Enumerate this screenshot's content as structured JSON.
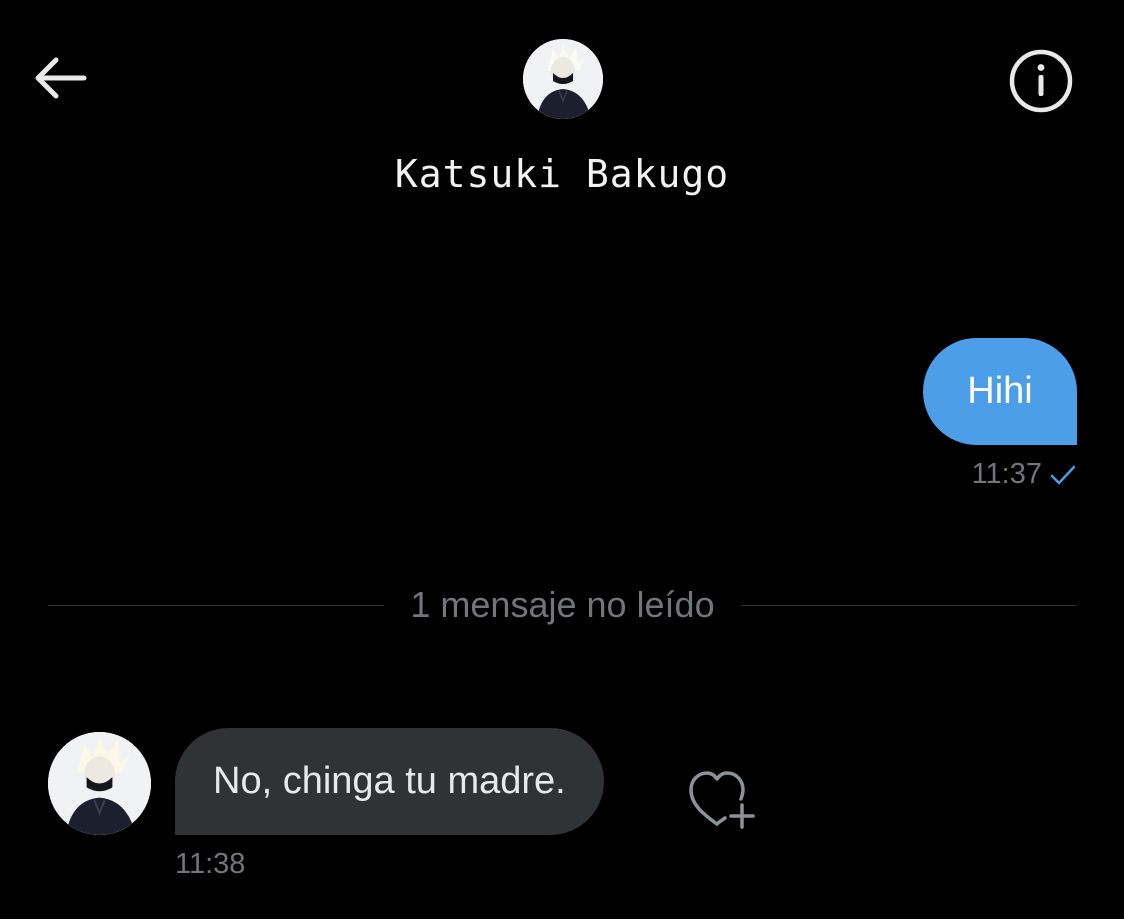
{
  "header": {
    "contact_name": "Katsuki Bakugo",
    "back_icon": "arrow-left-icon",
    "info_icon": "info-circle-icon"
  },
  "messages": {
    "outgoing": {
      "text": "Hihi",
      "time": "11:37",
      "status_icon": "checkmark-icon"
    },
    "unread_divider": "1 mensaje no leído",
    "incoming": {
      "text": "No, chinga tu madre.",
      "time": "11:38",
      "reaction_icon": "heart-plus-icon"
    }
  },
  "colors": {
    "background": "#000000",
    "accent": "#4c9ee8",
    "incoming_bubble": "#2f3336",
    "secondary_text": "#71767b"
  }
}
